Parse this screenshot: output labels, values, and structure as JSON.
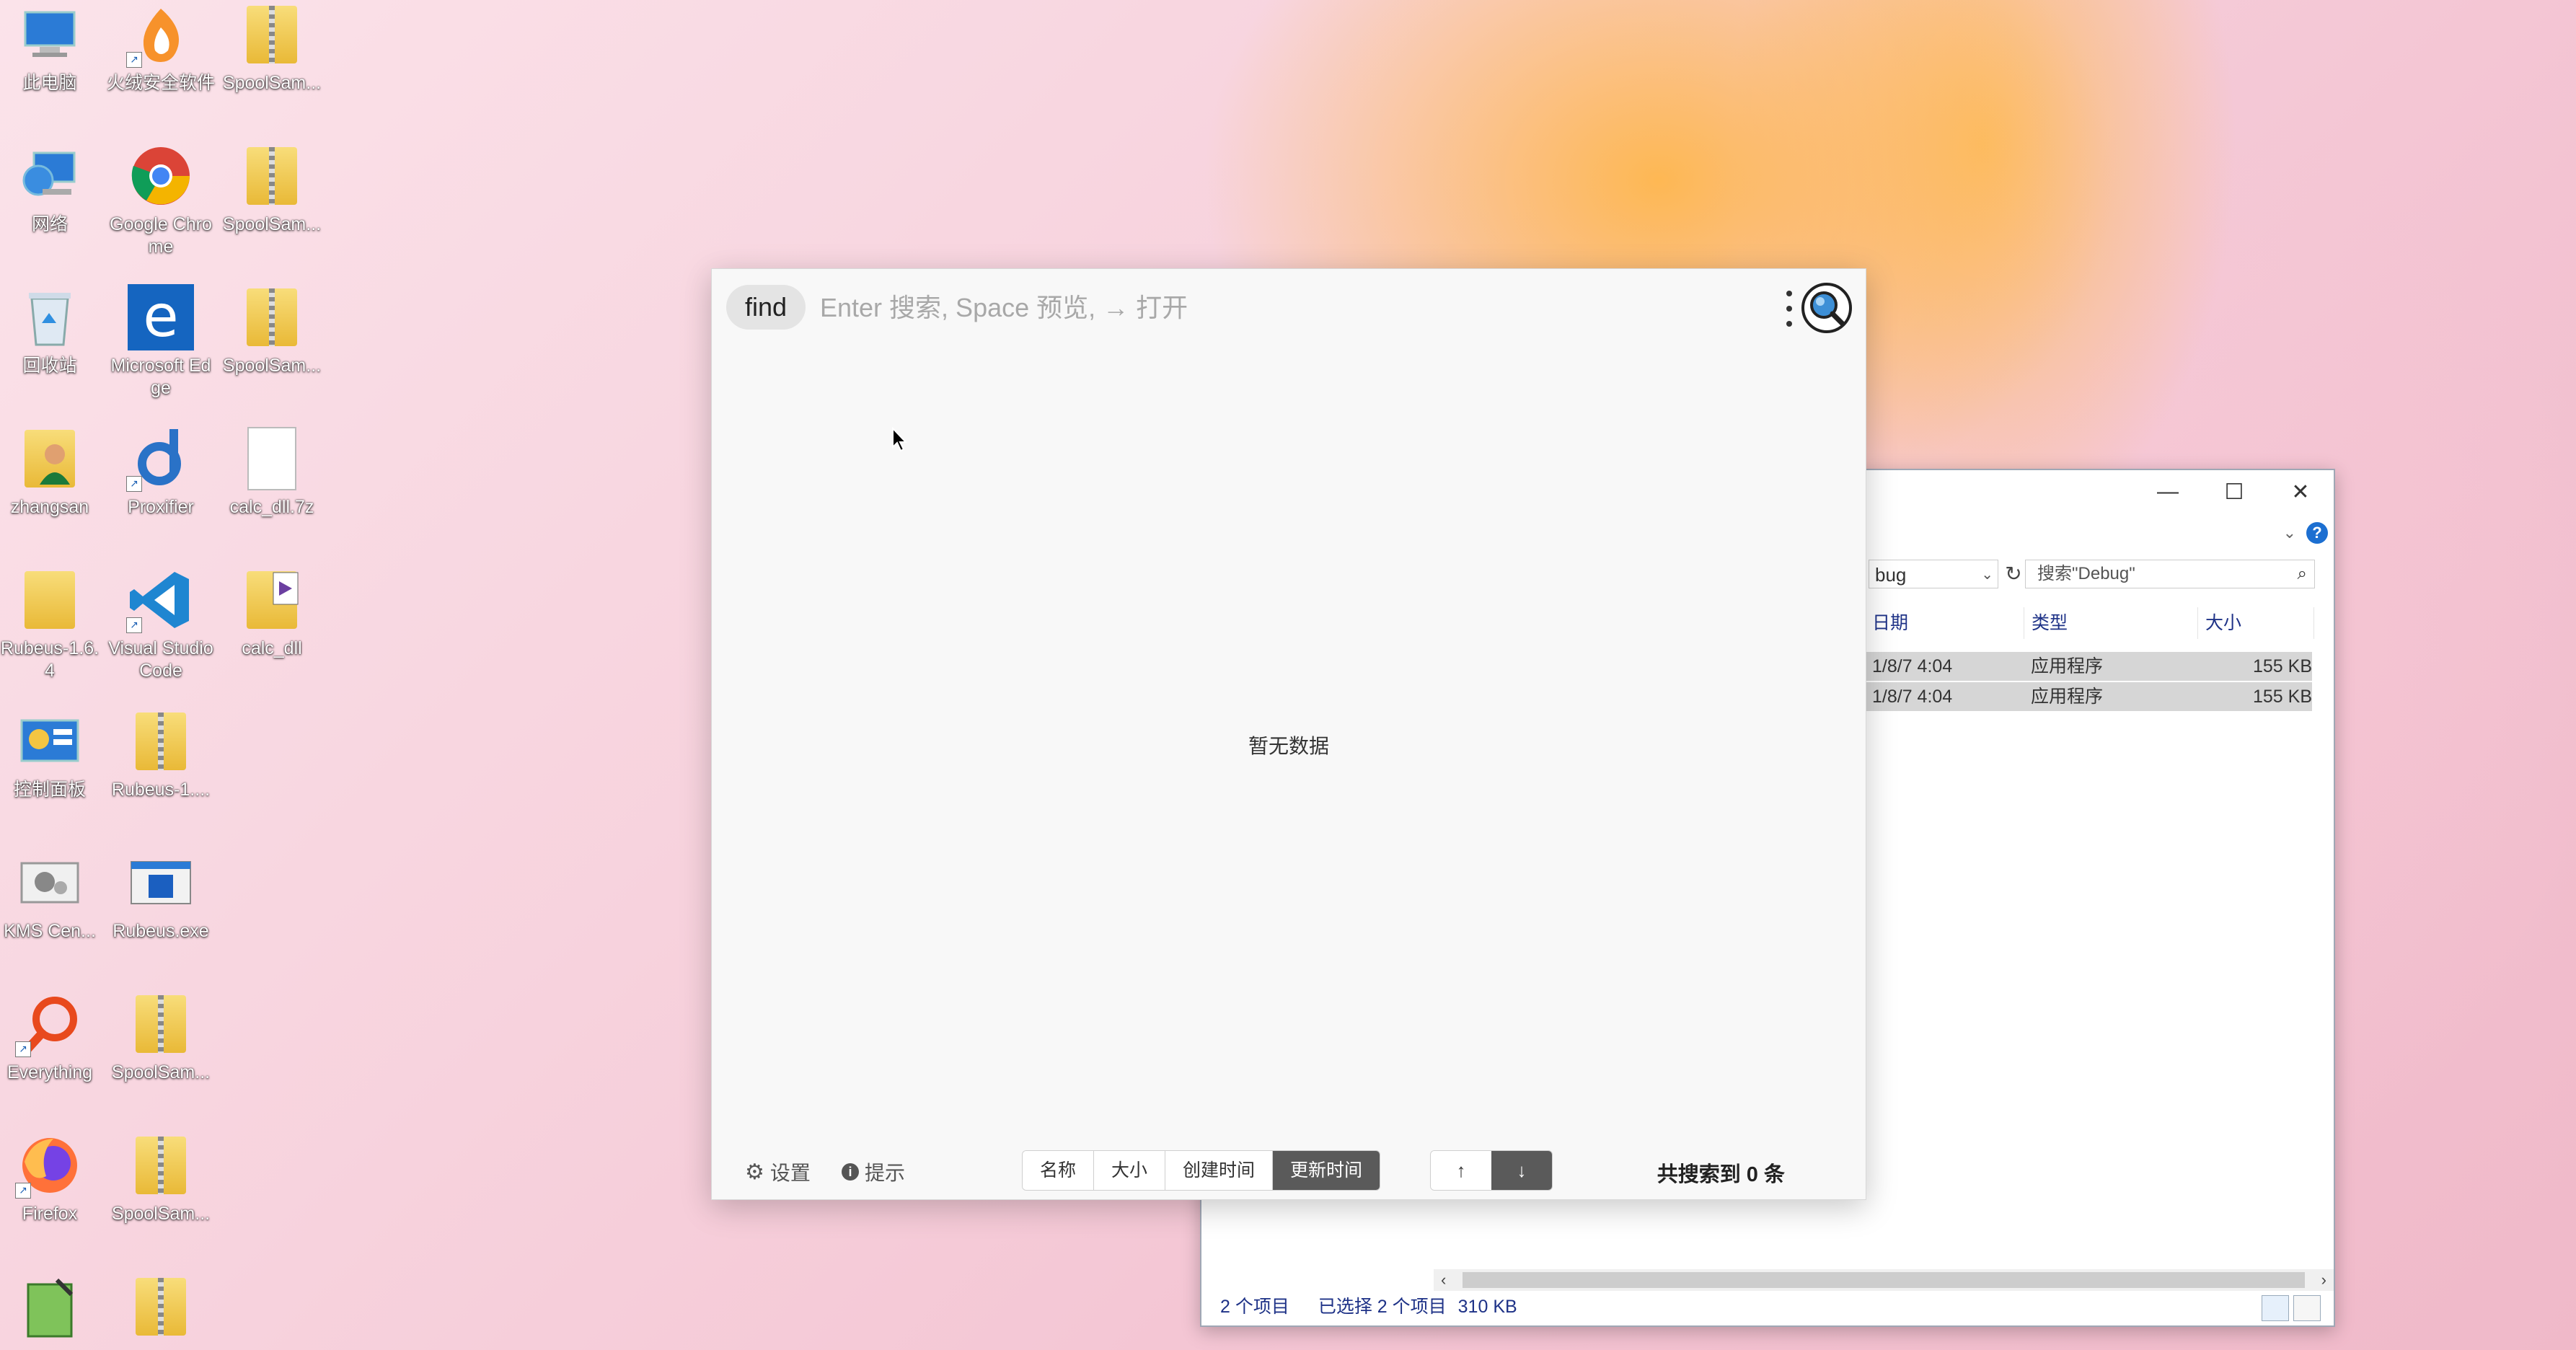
{
  "desktop": {
    "icons": [
      {
        "label": "此电脑",
        "icon": "computer-icon"
      },
      {
        "label": "火绒安全软件",
        "icon": "huorong-icon"
      },
      {
        "label": "SpoolSam...",
        "icon": "zip-folder-icon"
      },
      {
        "label": "网络",
        "icon": "network-icon"
      },
      {
        "label": "Google Chrome",
        "icon": "chrome-icon"
      },
      {
        "label": "SpoolSam...",
        "icon": "zip-folder-icon"
      },
      {
        "label": "回收站",
        "icon": "recycle-bin-icon"
      },
      {
        "label": "Microsoft Edge",
        "icon": "edge-icon"
      },
      {
        "label": "SpoolSam...",
        "icon": "zip-folder-icon"
      },
      {
        "label": "zhangsan",
        "icon": "user-folder-icon"
      },
      {
        "label": "Proxifier",
        "icon": "proxifier-icon"
      },
      {
        "label": "calc_dll.7z",
        "icon": "file-icon"
      },
      {
        "label": "Rubeus-1.6.4",
        "icon": "folder-icon"
      },
      {
        "label": "Visual Studio Code",
        "icon": "vscode-icon"
      },
      {
        "label": "calc_dll",
        "icon": "vs-project-folder-icon"
      },
      {
        "label": "控制面板",
        "icon": "control-panel-icon"
      },
      {
        "label": "Rubeus-1....",
        "icon": "zip-folder-icon"
      },
      {
        "label": "KMS Cen...",
        "icon": "kms-icon"
      },
      {
        "label": "Rubeus.exe",
        "icon": "exe-icon"
      },
      {
        "label": "Everything",
        "icon": "everything-icon"
      },
      {
        "label": "SpoolSam...",
        "icon": "zip-folder-icon"
      },
      {
        "label": "Firefox",
        "icon": "firefox-icon"
      },
      {
        "label": "SpoolSam...",
        "icon": "zip-folder-icon"
      }
    ]
  },
  "explorer": {
    "address": "bug",
    "search_placeholder": "搜索\"Debug\"",
    "columns": [
      "日期",
      "类型",
      "大小"
    ],
    "rows": [
      {
        "date": "1/8/7 4:04",
        "type": "应用程序",
        "size": "155 KB"
      },
      {
        "date": "1/8/7 4:04",
        "type": "应用程序",
        "size": "155 KB"
      }
    ],
    "status": {
      "items": "2 个项目",
      "selected": "已选择 2 个项目",
      "size": "310 KB"
    }
  },
  "find": {
    "tag": "find",
    "placeholder": "Enter 搜索, Space 预览, → 打开",
    "empty": "暂无数据",
    "settings": "设置",
    "tips": "提示",
    "sort_options": [
      "名称",
      "大小",
      "创建时间",
      "更新时间"
    ],
    "sort_active": "更新时间",
    "dir_up": "↑",
    "dir_down": "↓",
    "count_text": "共搜索到 0 条"
  },
  "colors": {
    "active_segment": "#5a5a5a",
    "selection_row": "#d6d6d6",
    "help_blue": "#1c6fd1"
  }
}
